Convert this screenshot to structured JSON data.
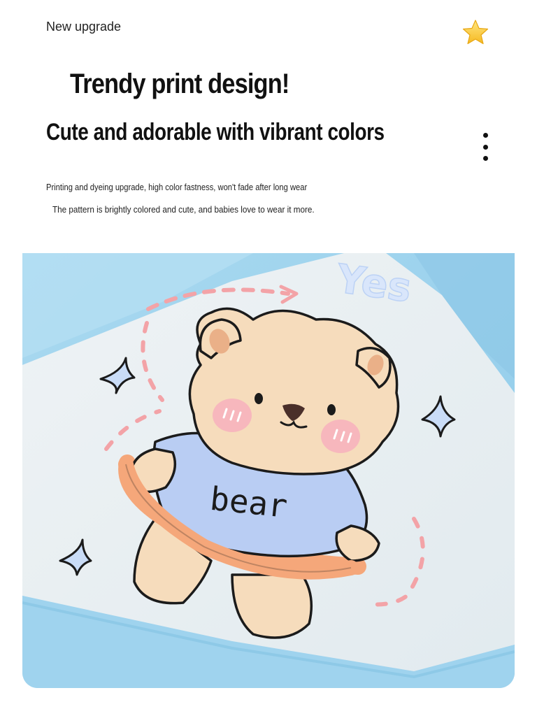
{
  "header": {
    "eyebrow": "New upgrade",
    "star_icon": "star-icon",
    "menu_icon": "more-vertical-icon"
  },
  "hero": {
    "headline": "Trendy print design!",
    "subheadline": "Cute and adorable with vibrant colors"
  },
  "description": {
    "line1": "Printing and dyeing upgrade, high color fastness, won't fade after long wear",
    "line2": "The pattern is brightly colored and cute, and babies love to wear it more."
  },
  "product_image": {
    "print_text_yes": "Yes",
    "print_text_shirt": "bear",
    "colors": {
      "fabric_blue": "#9fd3ee",
      "fabric_panel": "#eef2f4",
      "bear_fur": "#f6dcbc",
      "shirt": "#b9cdf3",
      "hoop": "#f5a77a",
      "cheeks": "#f7b7bd"
    }
  }
}
